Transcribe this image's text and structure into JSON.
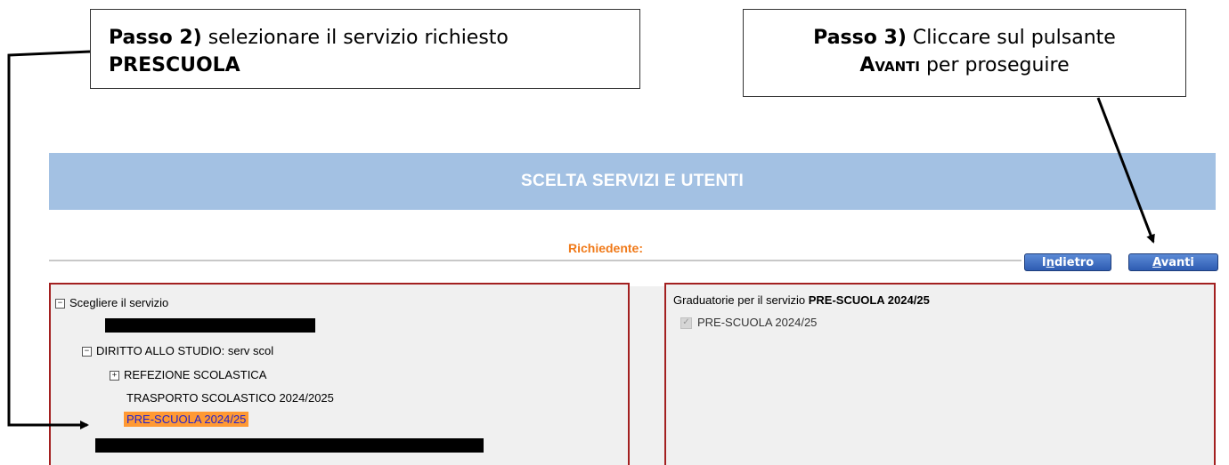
{
  "callouts": {
    "step2": {
      "label": "Passo 2)",
      "text": " selezionare il servizio richiesto",
      "highlight": "PRESCUOLA"
    },
    "step3": {
      "label": "Passo 3)",
      "text": " Cliccare sul pulsante",
      "highlight": "Avanti",
      "text_after": " per proseguire"
    }
  },
  "app": {
    "header_title": "SCELTA SERVIZI E UTENTI",
    "requester_label": "Richiedente:",
    "buttons": {
      "back_prefix": "I",
      "back_underlined": "n",
      "back_rest": "dietro",
      "next_underlined": "A",
      "next_rest": "vanti"
    },
    "tree": {
      "root": "Scegliere il servizio",
      "group": "DIRITTO ALLO STUDIO: serv scol",
      "items": [
        "REFEZIONE SCOLASTICA",
        "TRASPORTO SCOLASTICO 2024/2025",
        "PRE-SCUOLA 2024/25"
      ]
    },
    "rankings": {
      "title_prefix": "Graduatorie per il servizio ",
      "title_service": "PRE-SCUOLA 2024/25",
      "item": "PRE-SCUOLA 2024/25"
    }
  },
  "colors": {
    "header_bg": "#a3c1e3",
    "requester": "#f07a1a",
    "panel_border": "#a32020",
    "selected_bg": "#ff9933",
    "selected_text": "#2222cc",
    "button_bg": "#2e5cb2"
  }
}
